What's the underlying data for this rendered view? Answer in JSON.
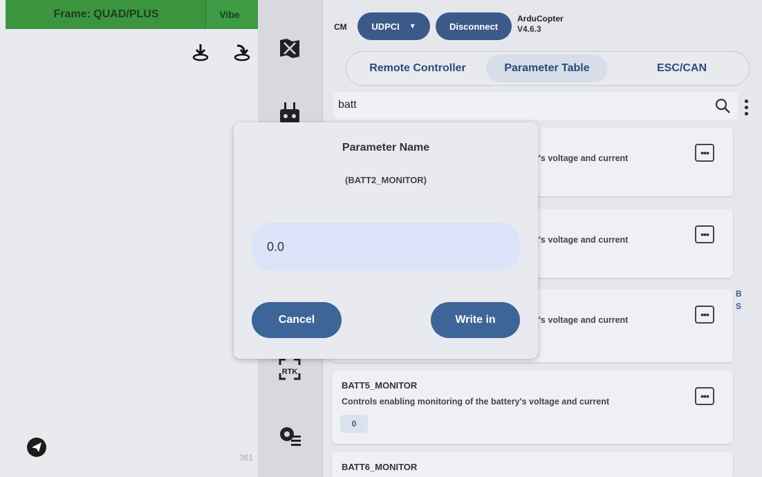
{
  "left_panel": {
    "frame_label": "Frame: QUAD/PLUS",
    "vibe_label": "Vibe",
    "map_icons": [
      "download-location-icon",
      "return-location-icon"
    ],
    "bottom_number": "361",
    "bottom_icon": "send-icon"
  },
  "rail": {
    "icons": [
      "map-icon",
      "remote-controller-icon",
      "rtk-icon",
      "settings-icon"
    ],
    "rtk_label": "RTK"
  },
  "header": {
    "cm_label": "CM",
    "connection_label": "UDPCI",
    "disconnect_label": "Disconnect",
    "firmware_name": "ArduCopter",
    "firmware_version": "V4.6.3"
  },
  "tabs": [
    {
      "label": "Remote Controller",
      "active": false
    },
    {
      "label": "Parameter Table",
      "active": true
    },
    {
      "label": "ESC/CAN",
      "active": false
    }
  ],
  "search": {
    "value": "batt"
  },
  "parameters": [
    {
      "name": "",
      "desc": "y's voltage and current",
      "value": ""
    },
    {
      "name": "",
      "desc": "y's voltage and current",
      "value": ""
    },
    {
      "name": "",
      "desc": "y's voltage and current",
      "value": ""
    },
    {
      "name": "BATT5_MONITOR",
      "desc": "Controls enabling monitoring of the battery's voltage and current",
      "value": "0"
    },
    {
      "name": "BATT6_MONITOR",
      "desc": "",
      "value": ""
    }
  ],
  "side_letters": [
    "B",
    "S"
  ],
  "dialog": {
    "title": "Parameter Name",
    "param": "(BATT2_MONITOR)",
    "input_value": "0.0",
    "cancel_label": "Cancel",
    "write_label": "Write in"
  },
  "colors": {
    "accent": "#3b5a8a",
    "frame_green": "#3e9a43",
    "input_bg": "#dbe4f8"
  }
}
